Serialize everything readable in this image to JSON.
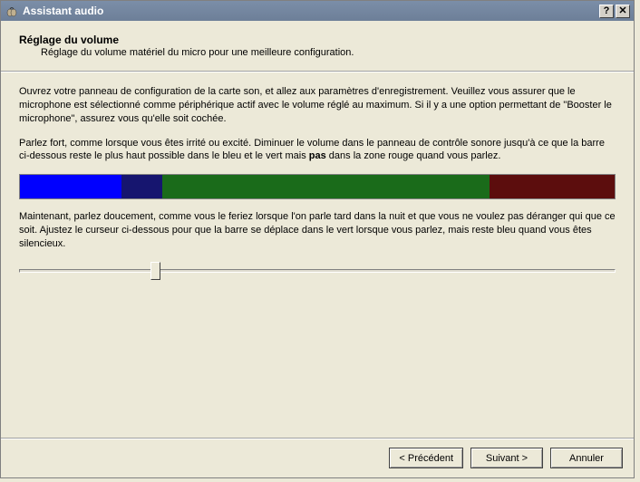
{
  "titlebar": {
    "title": "Assistant audio",
    "help_label": "?",
    "close_label": "✕"
  },
  "header": {
    "page_title": "Réglage du volume",
    "page_subtitle": "Réglage du volume matériel du micro pour une meilleure configuration."
  },
  "body": {
    "para1": "Ouvrez votre panneau de configuration de la carte son, et allez aux paramètres d'enregistrement. Veuillez vous assurer que le microphone est sélectionné comme périphérique actif avec le volume réglé au maximum. Si il y a une option permettant de \"Booster le microphone\", assurez vous qu'elle soit cochée.",
    "para2_pre": "Parlez fort, comme lorsque vous êtes irrité ou excité. Diminuer le volume dans le panneau de contrôle sonore jusqu'à ce que la barre ci-dessous reste le plus haut possible dans le bleu et le vert mais ",
    "para2_bold": "pas",
    "para2_post": " dans la zone rouge quand vous parlez.",
    "para3": "Maintenant, parlez doucement, comme vous le feriez lorsque l'on parle tard dans la nuit et que vous ne voulez pas déranger qui que ce soit. Ajustez le curseur ci-dessous pour que la barre se déplace dans le vert lorsque vous parlez, mais reste bleu quand vous êtes silencieux."
  },
  "volume_bar": {
    "segments": [
      {
        "color": "#0000ff",
        "width_pct": 17
      },
      {
        "color": "#16156f",
        "width_pct": 7
      },
      {
        "color": "#1a6b1a",
        "width_pct": 55
      },
      {
        "color": "#5c0d0d",
        "width_pct": 21
      }
    ]
  },
  "slider": {
    "position_pct": 22
  },
  "footer": {
    "prev_label": "< Précédent",
    "next_label": "Suivant >",
    "cancel_label": "Annuler"
  }
}
